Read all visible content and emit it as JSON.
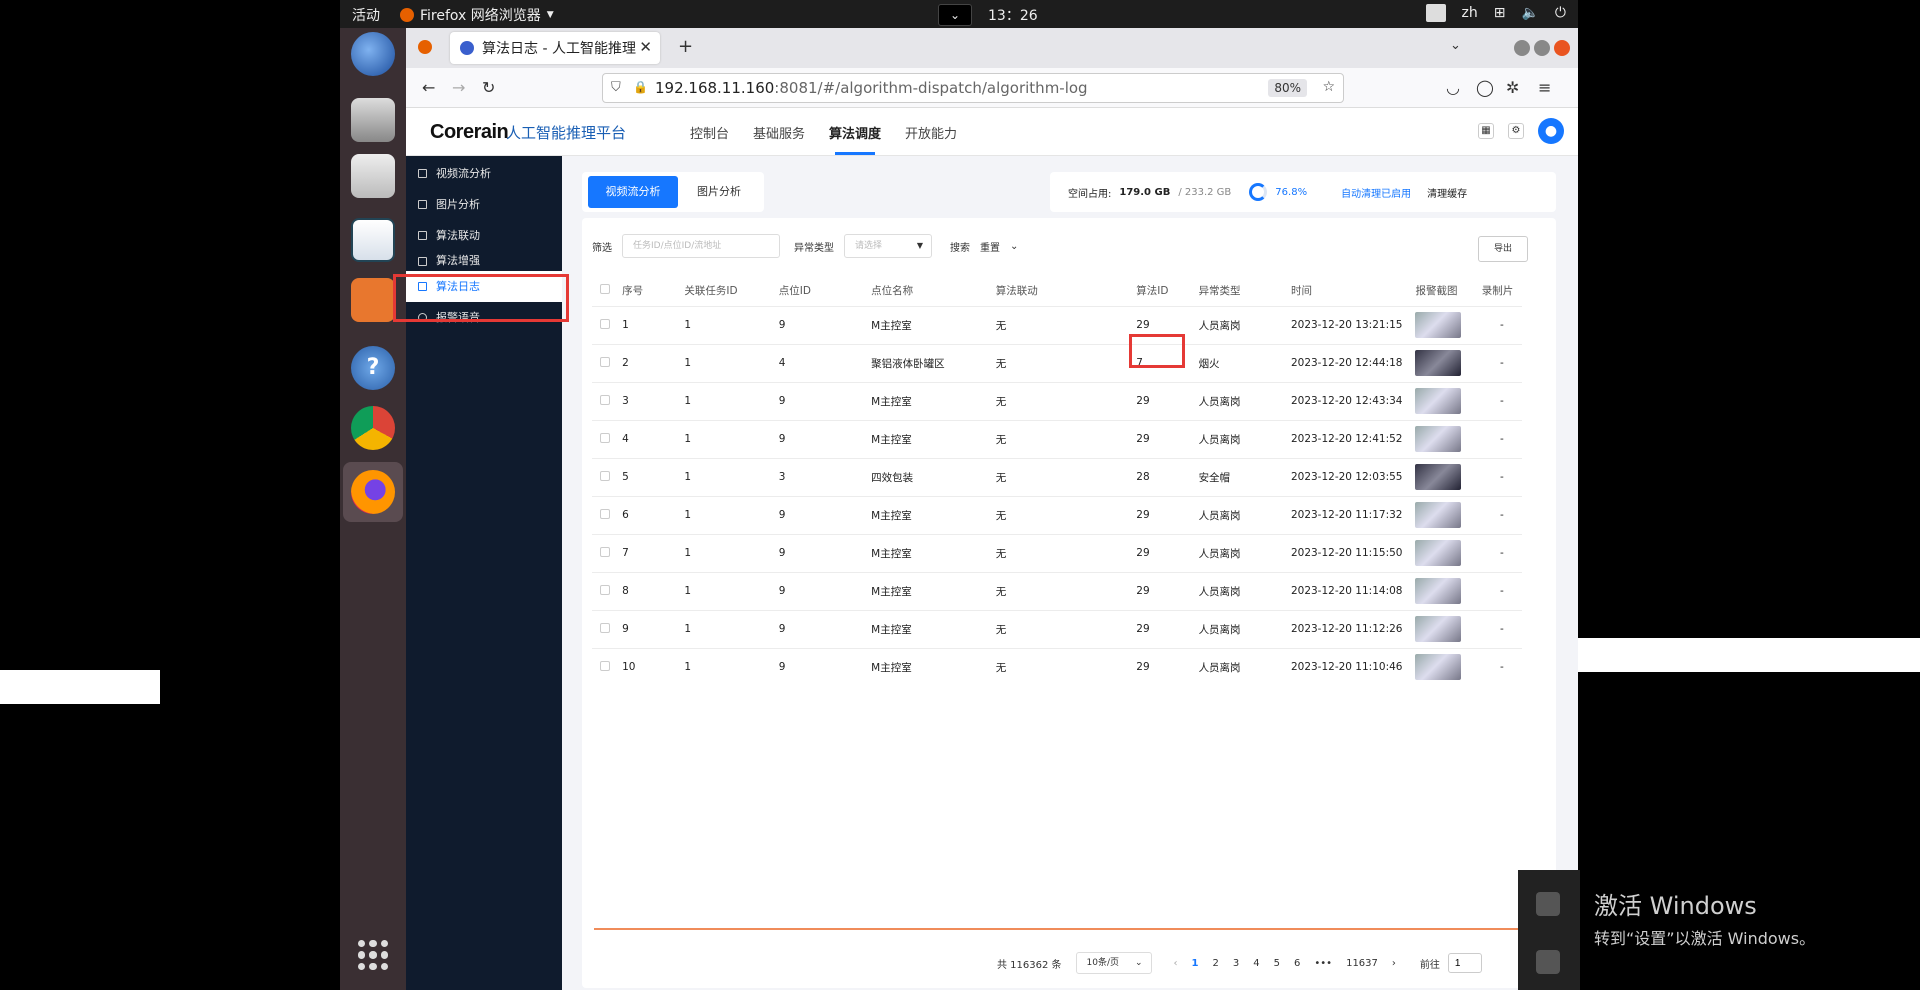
{
  "topbar": {
    "activities": "活动",
    "app_name": "Firefox 网络浏览器",
    "clock": "13：26",
    "lang": "zh"
  },
  "browser": {
    "tab_title": "算法日志 - 人工智能推理",
    "url_host": "192.168.11.160",
    "url_path": ":8081/#/algorithm-dispatch/algorithm-log",
    "zoom": "80%"
  },
  "app": {
    "logo": "Corerain",
    "platform": "人工智能推理平台",
    "nav": [
      "控制台",
      "基础服务",
      "算法调度",
      "开放能力"
    ],
    "active_nav": "算法调度"
  },
  "sidebar": {
    "items": [
      {
        "label": "视频流分析",
        "icon": "video-analysis-icon"
      },
      {
        "label": "图片分析",
        "icon": "image-analysis-icon"
      },
      {
        "label": "算法联动",
        "icon": "algorithm-link-icon"
      },
      {
        "label": "算法增强",
        "icon": "algorithm-enhance-icon"
      },
      {
        "label": "算法日志",
        "icon": "algorithm-log-icon"
      },
      {
        "label": "报警语音",
        "icon": "microphone-icon"
      }
    ],
    "active": "算法日志"
  },
  "toptabs": [
    "视频流分析",
    "图片分析"
  ],
  "storage": {
    "label": "空间占用:",
    "used": "179.0 GB",
    "total": "/ 233.2 GB",
    "percent": "76.8%",
    "auto_clean": "自动清理已启用",
    "clear_cache": "清理缓存"
  },
  "filter": {
    "label": "筛选",
    "input_placeholder": "任务ID/点位ID/流地址",
    "type_label": "异常类型",
    "type_placeholder": "请选择",
    "search": "搜索",
    "reset": "重置",
    "export": "导出"
  },
  "table": {
    "headers": [
      "序号",
      "关联任务ID",
      "点位ID",
      "点位名称",
      "算法联动",
      "算法ID",
      "异常类型",
      "时间",
      "报警截图",
      "录制片"
    ],
    "rows": [
      [
        "1",
        "1",
        "9",
        "M主控室",
        "无",
        "29",
        "人员离岗",
        "2023-12-20 13:21:15",
        "-"
      ],
      [
        "2",
        "1",
        "4",
        "聚铝液体卧罐区",
        "无",
        "7",
        "烟火",
        "2023-12-20 12:44:18",
        "-"
      ],
      [
        "3",
        "1",
        "9",
        "M主控室",
        "无",
        "29",
        "人员离岗",
        "2023-12-20 12:43:34",
        "-"
      ],
      [
        "4",
        "1",
        "9",
        "M主控室",
        "无",
        "29",
        "人员离岗",
        "2023-12-20 12:41:52",
        "-"
      ],
      [
        "5",
        "1",
        "3",
        "四效包装",
        "无",
        "28",
        "安全帽",
        "2023-12-20 12:03:55",
        "-"
      ],
      [
        "6",
        "1",
        "9",
        "M主控室",
        "无",
        "29",
        "人员离岗",
        "2023-12-20 11:17:32",
        "-"
      ],
      [
        "7",
        "1",
        "9",
        "M主控室",
        "无",
        "29",
        "人员离岗",
        "2023-12-20 11:15:50",
        "-"
      ],
      [
        "8",
        "1",
        "9",
        "M主控室",
        "无",
        "29",
        "人员离岗",
        "2023-12-20 11:14:08",
        "-"
      ],
      [
        "9",
        "1",
        "9",
        "M主控室",
        "无",
        "29",
        "人员离岗",
        "2023-12-20 11:12:26",
        "-"
      ],
      [
        "10",
        "1",
        "9",
        "M主控室",
        "无",
        "29",
        "人员离岗",
        "2023-12-20 11:10:46",
        "-"
      ]
    ]
  },
  "pagination": {
    "total": "共 116362 条",
    "page_size": "10条/页",
    "pages": [
      "1",
      "2",
      "3",
      "4",
      "5",
      "6"
    ],
    "ellipsis": "•••",
    "last": "11637",
    "goto_label": "前往",
    "goto_value": "1"
  },
  "watermark": {
    "line1": "激活 Windows",
    "line2": "转到“设置”以激活 Windows。"
  },
  "colors": {
    "accent": "#1677ff",
    "sidebar_bg": "#0f1b2d",
    "highlight": "#e53935"
  }
}
